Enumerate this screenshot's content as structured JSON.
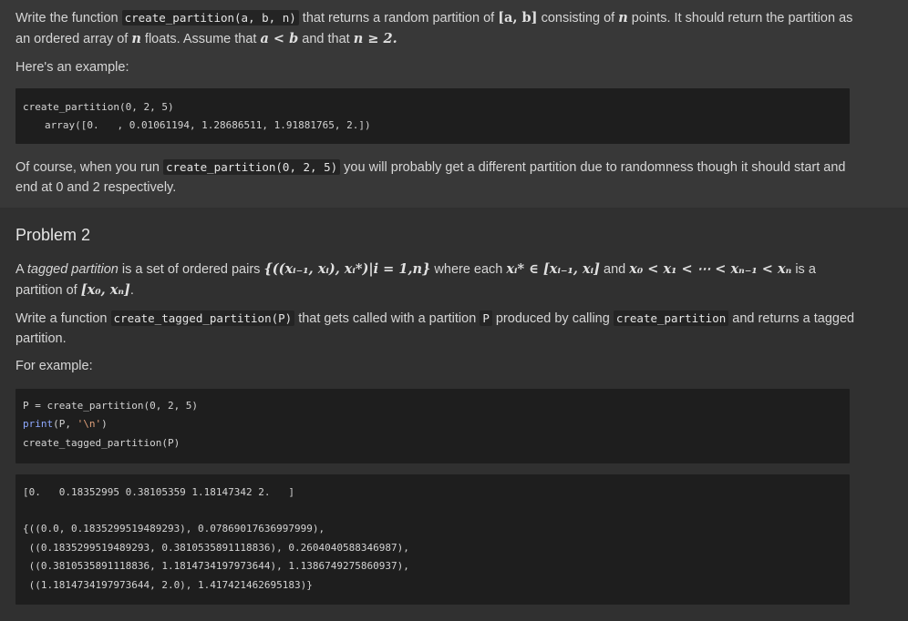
{
  "problem1": {
    "line1_a": "Write the function ",
    "func_sig": "create_partition(a, b, n)",
    "line1_b": " that returns a random partition of ",
    "interval": "[a, b]",
    "line1_c": " consisting of ",
    "var_n": "n",
    "line1_d": " points. It should return the partition as",
    "line2_a": "an ordered array of ",
    "line2_b": " floats. Assume that ",
    "cond_a_lt_b": "a < b",
    "line2_c": " and that ",
    "cond_n": "n ≥ 2.",
    "example_intro": "Here's an example:",
    "code_line1": "create_partition(0, 2, 5)",
    "code_line2": "array([0.   , 0.01061194, 1.28686511, 1.91881765, 2.])",
    "after_a": "Of course, when you run ",
    "after_code": "create_partition(0, 2, 5)",
    "after_b": " you will probably get a different partition due to randomness though it should start and",
    "after_c": "end at 0 and 2 respectively."
  },
  "problem2": {
    "heading": "Problem 2",
    "def_a": "A ",
    "def_em": "tagged partition",
    "def_b": " is a set of ordered pairs ",
    "def_set": "{((xᵢ₋₁, xᵢ), xᵢ*)|i = 1,n}",
    "def_c": " where each ",
    "def_elem": "xᵢ* ∈ [xᵢ₋₁, xᵢ]",
    "def_d": " and ",
    "def_order": "x₀ < x₁ < ⋯ < xₙ₋₁ < xₙ",
    "def_e": " is a",
    "def_f": "partition of ",
    "def_interval": "[x₀, xₙ]",
    "def_g": ".",
    "task_a": "Write a function ",
    "task_code1": "create_tagged_partition(P)",
    "task_b": " that gets called with a partition ",
    "task_code2": "P",
    "task_c": " produced by calling ",
    "task_code3": "create_partition",
    "task_d": " and returns a tagged",
    "task_e": "partition.",
    "example_intro": "For example:",
    "code1_line1": "P = create_partition(0, 2, 5)",
    "code1_line2_kw": "print",
    "code1_line2_a": "(P, ",
    "code1_line2_str": "'\\n'",
    "code1_line2_b": ")",
    "code1_line3": "create_tagged_partition(P)",
    "out_line1": "[0.   0.18352995 0.38105359 1.18147342 2.   ]",
    "out_line2": "{((0.0, 0.1835299519489293), 0.07869017636997999),",
    "out_line3": " ((0.1835299519489293, 0.3810535891118836), 0.2604040588346987),",
    "out_line4": " ((0.3810535891118836, 1.1814734197973644), 1.1386749275860937),",
    "out_line5": " ((1.1814734197973644, 2.0), 1.417421462695183)}"
  }
}
